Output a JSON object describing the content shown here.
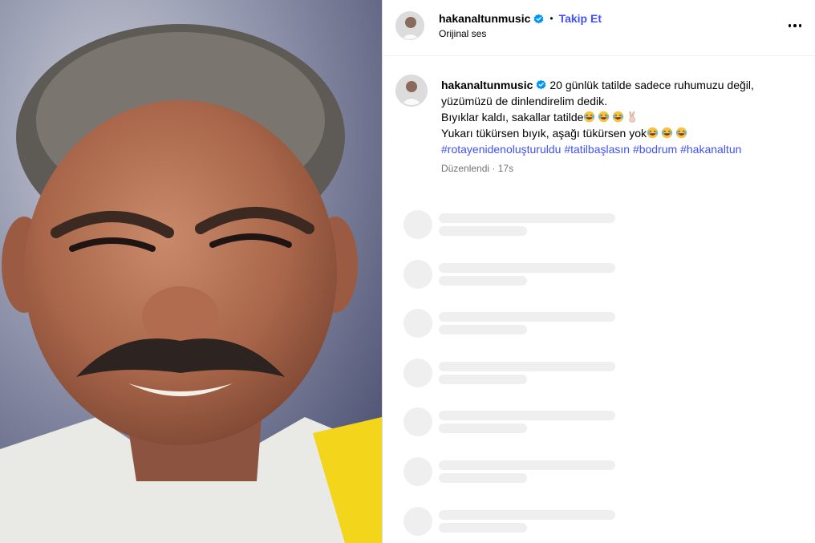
{
  "post": {
    "username": "hakanaltunmusic",
    "follow_label": "Takip Et",
    "separator": "•",
    "audio_label": "Orijinal ses"
  },
  "caption": {
    "username": "hakanaltunmusic",
    "line1": "20 günlük tatilde sadece ruhumuzu değil,",
    "line2": "yüzümüzü de dinlendirelim dedik.",
    "line3": "Bıyıklar kaldı, sakallar tatilde",
    "line4": "Yukarı tükürsen bıyık, aşağı tükürsen yok",
    "hashtags": [
      "#rotayenidenoluşturuldu",
      "#tatilbaşlasın",
      "#bodrum",
      "#hakanaltun"
    ],
    "edited_label": "Düzenlendi",
    "meta_separator": "·",
    "time": "17s"
  },
  "icons": {
    "verified": "verified-badge-icon",
    "more": "more-options-icon",
    "laughing_emoji": "laughing-emoji-icon",
    "victory_hand": "victory-hand-emoji-icon"
  },
  "colors": {
    "link_blue": "#4150f7",
    "verified_blue": "#0095f6",
    "meta_gray": "#737373",
    "skeleton_gray": "#efefef"
  },
  "comments_loading_rows": 7
}
